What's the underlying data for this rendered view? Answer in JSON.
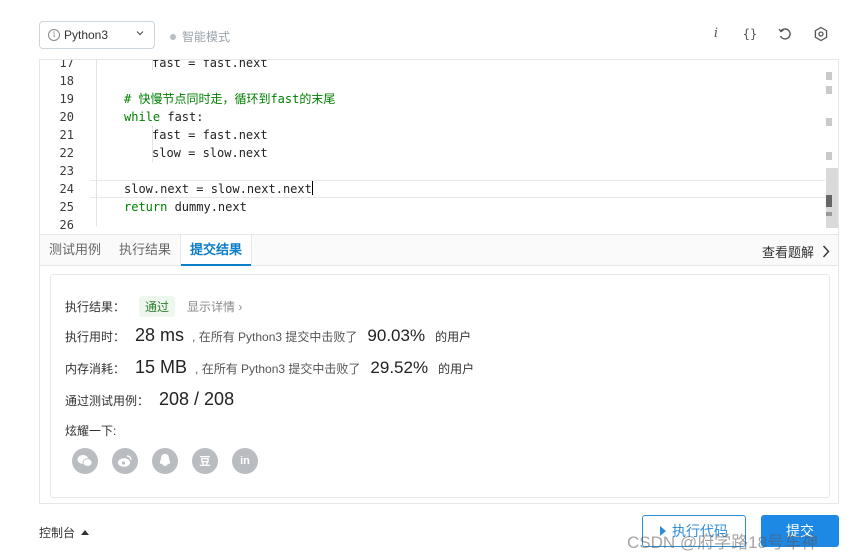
{
  "toolbar": {
    "language": "Python3",
    "smart_mode": "智能模式",
    "info_glyph": "i",
    "braces_glyph": "{}"
  },
  "editor": {
    "lines": [
      {
        "num": "17",
        "indent": 2,
        "code": "fast = fast.next"
      },
      {
        "num": "18",
        "indent": 0,
        "code": ""
      },
      {
        "num": "19",
        "indent": 1,
        "code": "# 快慢节点同时走，循环到fast的末尾"
      },
      {
        "num": "20",
        "indent": 1,
        "code": "while fast:"
      },
      {
        "num": "21",
        "indent": 2,
        "code": "fast = fast.next"
      },
      {
        "num": "22",
        "indent": 2,
        "code": "slow = slow.next"
      },
      {
        "num": "23",
        "indent": 0,
        "code": ""
      },
      {
        "num": "24",
        "indent": 1,
        "code": "slow.next = slow.next.next"
      },
      {
        "num": "25",
        "indent": 1,
        "code": "return dummy.next"
      },
      {
        "num": "26",
        "indent": 0,
        "code": ""
      }
    ]
  },
  "tabs": {
    "items": [
      "测试用例",
      "执行结果",
      "提交结果"
    ],
    "active_index": 2,
    "view_solution": "查看题解"
  },
  "result": {
    "status_label": "执行结果：",
    "status_value": "通过",
    "detail_link": "显示详情 ›",
    "time_label": "执行用时：",
    "time_value": "28 ms",
    "time_prefix": ", 在所有 Python3 提交中击败了",
    "time_pct": "90.03%",
    "time_suffix": "的用户",
    "mem_label": "内存消耗：",
    "mem_value": "15 MB",
    "mem_prefix": ", 在所有 Python3 提交中击败了",
    "mem_pct": "29.52%",
    "mem_suffix": "的用户",
    "cases_label": "通过测试用例：",
    "cases_value": "208 / 208",
    "share_label": "炫耀一下:",
    "share_icons": [
      "wechat-icon",
      "weibo-icon",
      "qq-icon",
      "douban-icon",
      "linkedin-icon"
    ],
    "douban_glyph": "豆",
    "linkedin_glyph": "in"
  },
  "bottom": {
    "console": "控制台",
    "run": "执行代码",
    "submit": "提交"
  },
  "watermark": "CSDN @府学路18号车神",
  "colors": {
    "accent": "#0d7ec8",
    "submit_bg": "#1e88e5",
    "pass_green": "#2e7d32"
  }
}
